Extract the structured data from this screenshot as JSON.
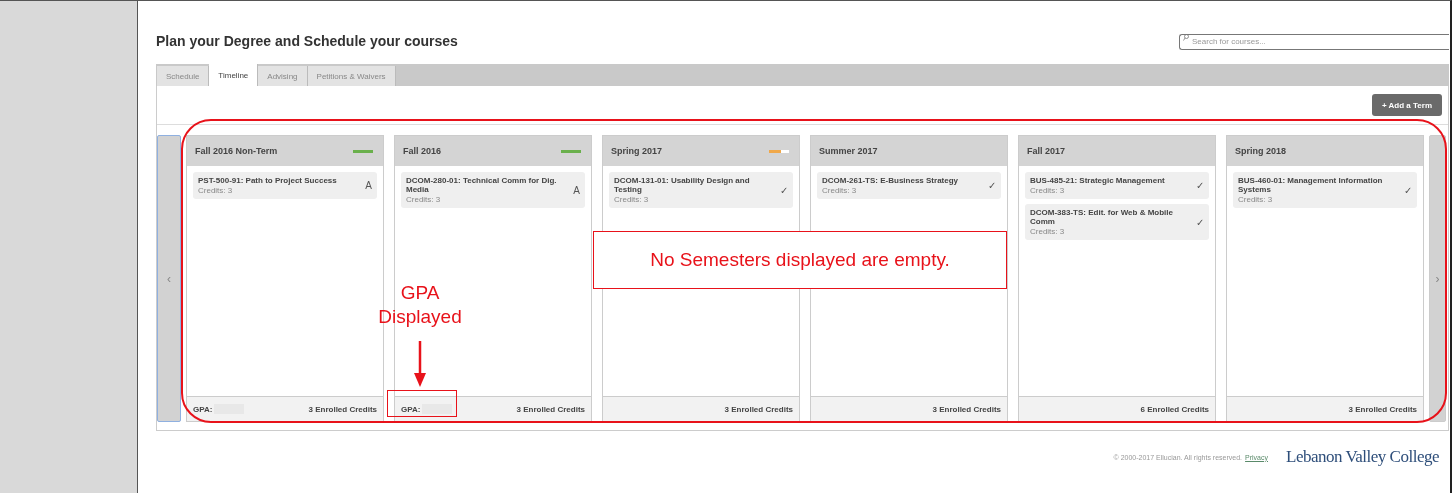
{
  "page": {
    "title": "Plan your Degree and Schedule your courses"
  },
  "search": {
    "placeholder": "Search for courses..."
  },
  "tabs": [
    {
      "label": "Schedule",
      "selected": false
    },
    {
      "label": "Timeline",
      "selected": true
    },
    {
      "label": "Advising",
      "selected": false
    },
    {
      "label": "Petitions & Waivers",
      "selected": false
    }
  ],
  "add_term_button": "+ Add a Term",
  "timeline": {
    "prev": "‹",
    "next": "›",
    "terms": [
      {
        "name": "Fall 2016 Non-Term",
        "progress": {
          "color": "#6ab04c",
          "level": 1
        },
        "courses": [
          {
            "title": "PST-500-91: Path to Project Success",
            "credits": "Credits: 3",
            "mark": "A"
          }
        ],
        "gpa": "GPA:",
        "enrolled": "3 Enrolled Credits"
      },
      {
        "name": "Fall 2016",
        "progress": {
          "color": "#6ab04c",
          "level": 1
        },
        "courses": [
          {
            "title": "DCOM-280-01: Technical Comm for Dig. Media",
            "credits": "Credits: 3",
            "mark": "A"
          }
        ],
        "gpa": "GPA:",
        "enrolled": "3 Enrolled Credits"
      },
      {
        "name": "Spring 2017",
        "progress": {
          "color": "#f0a84a",
          "level": 0.6
        },
        "courses": [
          {
            "title": "DCOM-131-01: Usability Design and Testing",
            "credits": "Credits: 3",
            "mark": "✓"
          }
        ],
        "enrolled": "3 Enrolled Credits"
      },
      {
        "name": "Summer 2017",
        "courses": [
          {
            "title": "DCOM-261-TS: E-Business Strategy",
            "credits": "Credits: 3",
            "mark": "✓"
          }
        ],
        "enrolled": "3 Enrolled Credits"
      },
      {
        "name": "Fall 2017",
        "courses": [
          {
            "title": "BUS-485-21: Strategic Management",
            "credits": "Credits: 3",
            "mark": "✓"
          },
          {
            "title": "DCOM-383-TS: Edit. for Web & Mobile Comm",
            "credits": "Credits: 3",
            "mark": "✓"
          }
        ],
        "enrolled": "6 Enrolled Credits"
      },
      {
        "name": "Spring 2018",
        "courses": [
          {
            "title": "BUS-460-01: Management Information Systems",
            "credits": "Credits: 3",
            "mark": "✓"
          }
        ],
        "enrolled": "3 Enrolled Credits"
      }
    ]
  },
  "footer": {
    "copyright": "© 2000-2017 Ellucian. All rights reserved.",
    "privacy_link": "Privacy",
    "logo": "Lebanon Valley College"
  },
  "annotations": {
    "note": "No Semesters displayed are empty.",
    "gpa_label": [
      "GPA",
      "Displayed"
    ]
  }
}
